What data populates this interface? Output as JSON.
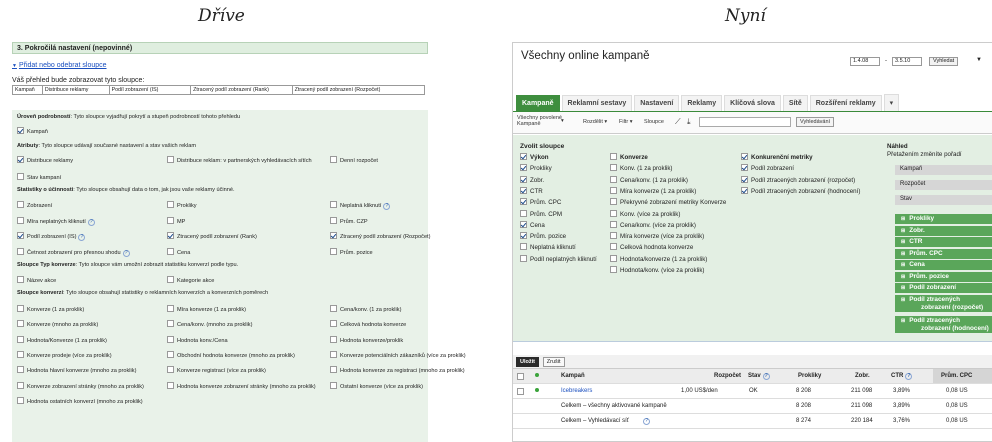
{
  "captions": {
    "before": "Dříve",
    "after": "Nyní"
  },
  "before": {
    "section_title": "3. Pokročilá nastavení (nepovinné)",
    "link": "Přidat nebo odebrat sloupce",
    "summary": "Váš přehled bude zobrazovat tyto sloupce:",
    "columns": [
      "Kampaň",
      "Distribuce reklamy",
      "Podíl zobrazení (IS)",
      "Ztracený podíl zobrazení (Rank)",
      "Ztracený podíl zobrazení (Rozpočet)"
    ],
    "level_title": "Úroveň podrobností",
    "level_desc": ": Tyto sloupce vyjadřují pokrytí a stupeň podrobností tohoto přehledu",
    "level_items": [
      {
        "label": "Kampaň",
        "checked": true
      }
    ],
    "attr_title": "Atributy",
    "attr_desc": ": Tyto sloupce udávají současné nastavení a stav vašich reklam",
    "attr_items": [
      {
        "label": "Distribuce reklamy",
        "checked": true
      },
      {
        "label": "Distribuce reklam: v partnerských vyhledávacích sítích",
        "checked": false
      },
      {
        "label": "Denní rozpočet",
        "checked": false
      },
      {
        "label": "Stav kampaní",
        "checked": false
      }
    ],
    "perf_title": "Statistiky o účinnosti",
    "perf_desc": ": Tyto sloupce obsahují data o tom, jak jsou vaše reklamy účinné.",
    "perf_items": [
      {
        "label": "Zobrazení",
        "checked": false,
        "help": false
      },
      {
        "label": "Prokliky",
        "checked": false,
        "help": false
      },
      {
        "label": "Neplatná kliknutí",
        "checked": false,
        "help": true
      },
      {
        "label": "Míra neplatných kliknutí",
        "checked": false,
        "help": true
      },
      {
        "label": "MP",
        "checked": false,
        "help": false
      },
      {
        "label": "Prům. CZP",
        "checked": false,
        "help": false
      },
      {
        "label": "Podíl zobrazení (IS)",
        "checked": true,
        "help": true
      },
      {
        "label": "Ztracený podíl zobrazení (Rank)",
        "checked": true,
        "help": false
      },
      {
        "label": "Ztracený podíl zobrazení (Rozpočet)",
        "checked": true,
        "help": false
      },
      {
        "label": "Četnost zobrazení pro přesnou shodu",
        "checked": false,
        "help": true
      },
      {
        "label": "Cena",
        "checked": false,
        "help": false
      },
      {
        "label": "Prům. pozice",
        "checked": false,
        "help": false
      }
    ],
    "convtype_title": "Sloupce Typ konverze",
    "convtype_desc": ": Tyto sloupce vám umožní zobrazit statistiku konverzí podle typu.",
    "convtype_items": [
      {
        "label": "Název akce",
        "checked": false
      },
      {
        "label": "Kategorie akce",
        "checked": false
      }
    ],
    "conv_title": "Sloupce konverzí",
    "conv_desc": ": Tyto sloupce obsahují statistiky o reklamních konverzích a konverzních poměrech",
    "conv_items": [
      {
        "label": "Konverze (1 za proklik)",
        "checked": false
      },
      {
        "label": "Míra konverze (1 za proklik)",
        "checked": false
      },
      {
        "label": "Cena/konv. (1 za proklik)",
        "checked": false
      },
      {
        "label": "Konverze (mnoho za proklik)",
        "checked": false
      },
      {
        "label": "Cena/konv. (mnoho za proklik)",
        "checked": false
      },
      {
        "label": "Celková hodnota konverze",
        "checked": false
      },
      {
        "label": "Hodnota/Konverze (1 za proklik)",
        "checked": false
      },
      {
        "label": "Hodnota konv./Cena",
        "checked": false
      },
      {
        "label": "Hodnota konverze/proklik",
        "checked": false
      },
      {
        "label": "Konverze prodeje (více za proklik)",
        "checked": false
      },
      {
        "label": "Obchodní hodnota konverze (mnoho za proklik)",
        "checked": false
      },
      {
        "label": "Konverze potenciálních zákazníků (více za proklik)",
        "checked": false
      },
      {
        "label": "Hodnota hlavní konverze (mnoho za proklik)",
        "checked": false
      },
      {
        "label": "Konverze registrací (více za proklik)",
        "checked": false
      },
      {
        "label": "Hodnota konverze za registraci (mnoho za proklik)",
        "checked": false
      },
      {
        "label": "Konverze zobrazení stránky (mnoho za proklik)",
        "checked": false
      },
      {
        "label": "Hodnota konverze zobrazení stránky (mnoho za proklik)",
        "checked": false
      },
      {
        "label": "Ostatní konverze (více za proklik)",
        "checked": false
      },
      {
        "label": "Hodnota ostatních konverzí (mnoho za proklik)",
        "checked": false
      }
    ]
  },
  "after": {
    "title": "Všechny online kampaně",
    "date_from": "1.4.08",
    "date_sep": "-",
    "date_to": "3.5.10",
    "search_button": "Vyhledat",
    "tabs": [
      "Kampaně",
      "Reklamní sestavy",
      "Nastavení",
      "Reklamy",
      "Klíčová slova",
      "Sítě",
      "Rozšíření reklamy"
    ],
    "active_tab": 0,
    "toolbar": {
      "filter_select": "Všechny povolené Kampaně",
      "segment": "Rozdělit ▾",
      "filter": "Filtr ▾",
      "columns": "Sloupce",
      "search_btn": "Vyhledávání"
    },
    "chooser_title": "Zvolit sloupce",
    "col1": [
      {
        "label": "Výkon",
        "checked": true,
        "bold": true
      },
      {
        "label": "Prokliky",
        "checked": true
      },
      {
        "label": "Zobr.",
        "checked": true
      },
      {
        "label": "CTR",
        "checked": true
      },
      {
        "label": "Prům. CPC",
        "checked": true
      },
      {
        "label": "Prům. CPM",
        "checked": false
      },
      {
        "label": "Cena",
        "checked": true
      },
      {
        "label": "Prům. pozice",
        "checked": true
      },
      {
        "label": "Neplatná kliknutí",
        "checked": false
      },
      {
        "label": "Podíl neplatných kliknutí",
        "checked": false
      }
    ],
    "col2": [
      {
        "label": "Konverze",
        "checked": false,
        "bold": true
      },
      {
        "label": "Konv. (1 za proklik)",
        "checked": false
      },
      {
        "label": "Cena/konv. (1 za proklik)",
        "checked": false
      },
      {
        "label": "Míra konverze (1 za proklik)",
        "checked": false
      },
      {
        "label": "Překryvné zobrazení metriky Konverze",
        "checked": false
      },
      {
        "label": "Konv. (více za proklik)",
        "checked": false
      },
      {
        "label": "Cena/konv. (více za proklik)",
        "checked": false
      },
      {
        "label": "Míra konverze (více za proklik)",
        "checked": false
      },
      {
        "label": "Celková hodnota konverze",
        "checked": false
      },
      {
        "label": "Hodnota/konverze (1 za proklik)",
        "checked": false
      },
      {
        "label": "Hodnota/konv. (více za proklik)",
        "checked": false
      }
    ],
    "col3": [
      {
        "label": "Konkurenční metriky",
        "checked": true,
        "bold": true
      },
      {
        "label": "Podíl zobrazení",
        "checked": true
      },
      {
        "label": "Podíl ztracených zobrazení (rozpočet)",
        "checked": true
      },
      {
        "label": "Podíl ztracených zobrazení (hodnocení)",
        "checked": true
      }
    ],
    "preview_title": "Náhled",
    "preview_sub": "Přetažením změníte pořadí",
    "preview_fixed": [
      "Kampaň",
      "Rozpočet",
      "Stav"
    ],
    "preview_cols": [
      "Prokliky",
      "Zobr.",
      "CTR",
      "Prům. CPC",
      "Cena",
      "Prům. pozice",
      "Podíl zobrazení",
      "Podíl ztracených zobrazení (rozpočet)",
      "Podíl ztracených zobrazení (hodnocení)"
    ],
    "save_btn": "Uložit",
    "cancel_btn": "Zrušit",
    "table_headers": {
      "campaign": "Kampaň",
      "budget": "Rozpočet",
      "status": "Stav",
      "clicks": "Prokliky",
      "impr": "Zobr.",
      "ctr": "CTR",
      "cpc": "Prům. CPC"
    },
    "rows": [
      {
        "campaign": "Icebreakers",
        "budget": "1,00 US$/den",
        "status": "OK",
        "clicks": "8 208",
        "impr": "211 098",
        "ctr": "3,89%",
        "cpc": "0,08 US"
      },
      {
        "campaign": "Celkem – všechny aktivované kampaně",
        "budget": "",
        "status": "",
        "clicks": "8 208",
        "impr": "211 098",
        "ctr": "3,89%",
        "cpc": "0,08 US"
      },
      {
        "campaign": "Celkem – Vyhledávací síť",
        "budget": "",
        "status": "",
        "clicks": "8 274",
        "impr": "220 184",
        "ctr": "3,76%",
        "cpc": "0,08 US"
      }
    ]
  }
}
